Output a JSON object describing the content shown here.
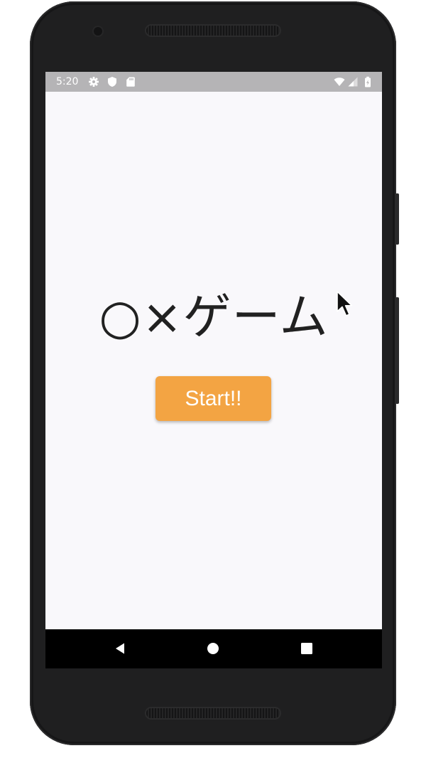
{
  "status_bar": {
    "time": "5:20",
    "left_icons": [
      "settings-icon",
      "shield-icon",
      "sd-card-icon"
    ],
    "right_icons": [
      "wifi-icon",
      "cell-signal-icon",
      "battery-icon"
    ]
  },
  "app": {
    "title": "○×ゲーム",
    "start_button_label": "Start!!",
    "background_color": "#f9f8fb",
    "accent_color": "#f3a443"
  },
  "nav_bar": {
    "icons": [
      "back-icon",
      "home-icon",
      "recents-icon"
    ]
  }
}
